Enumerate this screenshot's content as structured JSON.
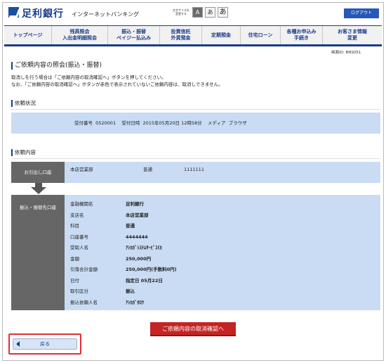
{
  "header": {
    "bank_name": "足利銀行",
    "service_name": "インターネットバンキング",
    "font_size_label": "文字サイズを\n変更する",
    "font_size_buttons": [
      "A",
      "あ",
      "あ"
    ],
    "logout_label": "ログアウト"
  },
  "nav": {
    "items": [
      {
        "label": "トップページ",
        "width": 68
      },
      {
        "label": "残高照会\n入出金明細照会",
        "width": 80
      },
      {
        "label": "振込・振替\nペイジー払込み",
        "width": 74
      },
      {
        "label": "投資信託\n外貨預金",
        "width": 60
      },
      {
        "label": "定期預金",
        "width": 55
      },
      {
        "label": "住宅ローン",
        "width": 57
      },
      {
        "label": "各種お申込み\n手続き",
        "width": 60
      },
      {
        "label": "お客さま情報\n変更",
        "width": 84
      }
    ]
  },
  "screen_id": "画面ID: BNS051",
  "page_title": "ご依頼内容の照会(振込・振替)",
  "notice_lines": [
    "取消しを行う場合は「ご依頼内容の取消確認へ」ボタンを押してください。",
    "なお、「ご依頼内容の取消確認へ」ボタンが赤色で表示されていないご依頼内容は、取消しできません。"
  ],
  "status_section": {
    "title": "依頼状況",
    "line": "受付番号  0520001    受付日時  2015年05月20日 12時58分    メディア  ブラウザ"
  },
  "content_section": {
    "title": "依頼内容",
    "from_label": "お引出し口座",
    "from_branch": "本店営業部",
    "from_type": "普通",
    "from_number": "1111111",
    "to_label": "振込・振替先口座",
    "details": [
      {
        "key": "金融機関名",
        "value": "足利銀行"
      },
      {
        "key": "支店名",
        "value": "本店営業部"
      },
      {
        "key": "科目",
        "value": "普通"
      },
      {
        "key": "口座番号",
        "value": "4444444"
      },
      {
        "key": "受取人名",
        "value": "ｱｼｶｶﾞｼｽﾃﾑｻｰﾋﾞｽ(ｶ"
      },
      {
        "key": "金額",
        "value": "250,000円"
      },
      {
        "key": "引落合計金額",
        "value": "250,000円(手数料0円)"
      },
      {
        "key": "日付",
        "value": "指定日 05月22日"
      },
      {
        "key": "取引区分",
        "value": "振込"
      },
      {
        "key": "振込依頼人名",
        "value": "ｱｼｶｶﾞﾀﾛｳ"
      }
    ]
  },
  "buttons": {
    "cancel_label": "ご依頼内容の取消確認へ",
    "back_label": "戻る"
  },
  "colors": {
    "brand": "#1a3c8a",
    "row_bg": "#c9dcf4",
    "cancel": "#c42424",
    "highlight": "#e03030"
  }
}
